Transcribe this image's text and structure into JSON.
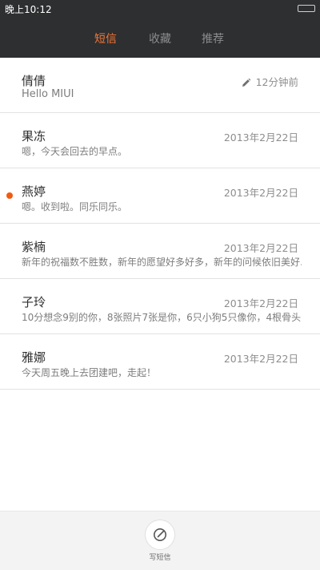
{
  "status_bar": {
    "time": "晚上10:12"
  },
  "tabs": [
    {
      "label": "短信",
      "active": true
    },
    {
      "label": "收藏",
      "active": false
    },
    {
      "label": "推荐",
      "active": false
    }
  ],
  "colors": {
    "accent": "#f27536",
    "header_bg": "#2d2f31",
    "unread": "#f25a0f"
  },
  "conversations": [
    {
      "name": "倩倩",
      "preview": "Hello MIUI",
      "time": "12分钟前",
      "icon": "pencil-icon",
      "unread": false
    },
    {
      "name": "果冻",
      "preview": "嗯，今天会回去的早点。",
      "time": "2013年2月22日",
      "unread": false
    },
    {
      "name": "燕婷",
      "preview": "嗯。收到啦。同乐同乐。",
      "time": "2013年2月22日",
      "unread": true
    },
    {
      "name": "紫楠",
      "preview": "新年的祝福数不胜数，新年的愿望好多好多，新年的问候依旧美好…",
      "time": "2013年2月22日",
      "unread": false
    },
    {
      "name": "子玲",
      "preview": "10分想念9别的你，8张照片7张是你，6只小狗5只像你，4根骨头…",
      "time": "2013年2月22日",
      "unread": false
    },
    {
      "name": "雅娜",
      "preview": "今天周五晚上去团建吧，走起！",
      "time": "2013年2月22日",
      "unread": false
    }
  ],
  "bottom_bar": {
    "compose_label": "写短信",
    "icon": "compose-icon"
  }
}
